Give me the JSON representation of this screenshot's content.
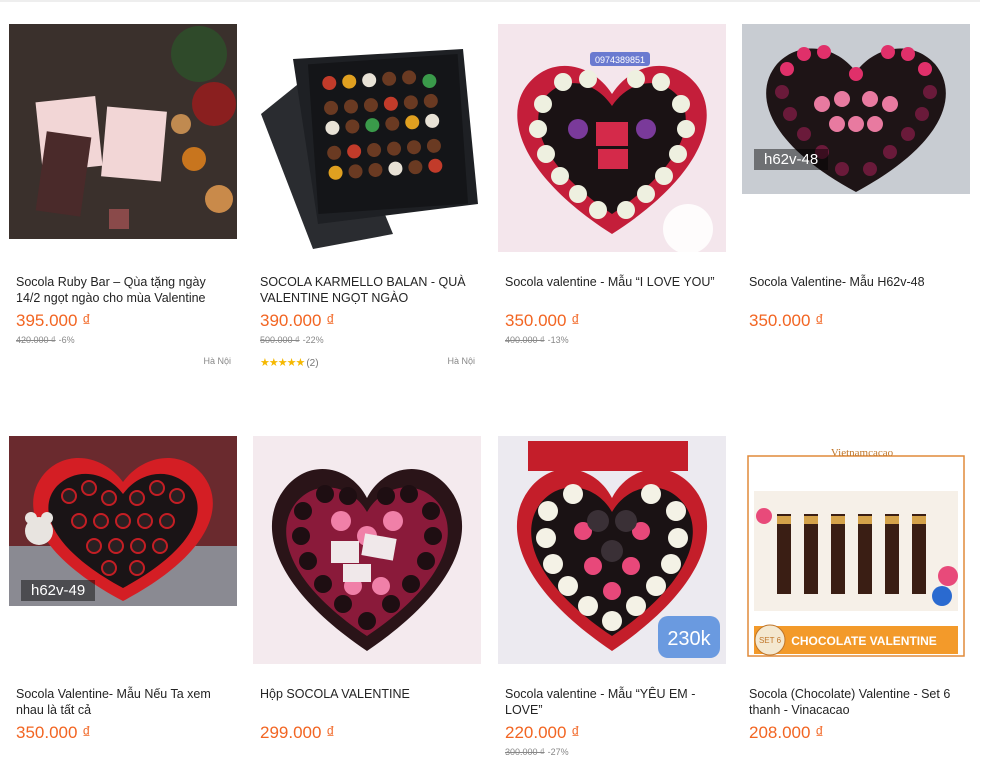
{
  "colors": {
    "price": "#f26522",
    "text": "#242424",
    "muted": "#888888",
    "star": "#f5b800"
  },
  "products": [
    {
      "name": "Socola Ruby Bar – Qùa tặng ngày 14/2 ngọt ngào cho mùa Valentine",
      "price": "395.000 ₫",
      "old_price": "420.000 ₫",
      "discount": "-6%",
      "location": "Hà Nội",
      "rating_stars": "",
      "rating_count": "",
      "image": "ruby-bar-image",
      "tag": ""
    },
    {
      "name": "SOCOLA KARMELLO BALAN - QUÀ VALENTINE NGỌT NGÀO",
      "price": "390.000 ₫",
      "old_price": "500.000 ₫",
      "discount": "-22%",
      "location": "Hà Nội",
      "rating_stars": "★★★★★",
      "rating_count": "(2)",
      "image": "karmello-box-image",
      "tag": ""
    },
    {
      "name": "Socola valentine - Mẫu “I LOVE YOU”",
      "price": "350.000 ₫",
      "old_price": "400.000 ₫",
      "discount": "-13%",
      "location": "",
      "rating_stars": "",
      "rating_count": "",
      "image": "i-love-you-heart-image",
      "tag": ""
    },
    {
      "name": "Socola Valentine- Mẫu H62v-48",
      "price": "350.000 ₫",
      "old_price": "",
      "discount": "",
      "location": "",
      "rating_stars": "",
      "rating_count": "",
      "image": "h62v48-heart-image",
      "tag": "h62v-48"
    },
    {
      "name": "Socola Valentine- Mẫu Nếu Ta xem nhau là tất cả",
      "price": "350.000 ₫",
      "old_price": "",
      "discount": "",
      "location": "",
      "rating_stars": "",
      "rating_count": "",
      "image": "h62v49-heart-image",
      "tag": "h62v-49"
    },
    {
      "name": "Hộp SOCOLA VALENTINE",
      "price": "299.000 ₫",
      "old_price": "",
      "discount": "",
      "location": "",
      "rating_stars": "",
      "rating_count": "",
      "image": "pink-heart-box-image",
      "tag": ""
    },
    {
      "name": "Socola valentine - Mẫu “YÊU EM - LOVE”",
      "price": "220.000 ₫",
      "old_price": "300.000 ₫",
      "discount": "-27%",
      "location": "",
      "rating_stars": "",
      "rating_count": "",
      "image": "yeu-em-heart-image",
      "tag": ""
    },
    {
      "name": "Socola (Chocolate) Valentine - Set 6 thanh - Vinacacao",
      "price": "208.000 ₫",
      "old_price": "",
      "discount": "",
      "location": "",
      "rating_stars": "",
      "rating_count": "",
      "image": "vinacacao-set-image",
      "tag": ""
    }
  ],
  "image_text": {
    "phone": "0974389851",
    "h62v48_badge": "h62v-48",
    "h62v49_badge": "h62v-49",
    "price_230k": "230k",
    "vinacacao_brand": "Vietnamcacao",
    "set_label": "SET 6",
    "set_banner": "CHOCOLATE VALENTINE"
  }
}
